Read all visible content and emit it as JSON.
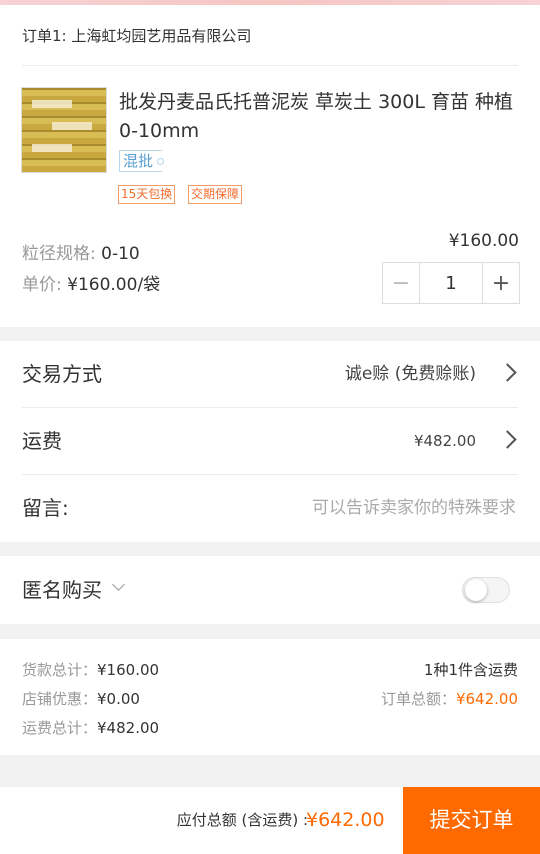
{
  "order": {
    "seller": "订单1: 上海虹均园艺用品有限公司",
    "product_title": "批发丹麦品氏托普泥炭 草炭土 300L 育苗 种植 0-10mm",
    "tag_mixed": "混批",
    "badges": [
      "15天包换",
      "交期保障"
    ],
    "spec_label": "粒径规格:",
    "spec_value": "0-10",
    "unit_price_label": "单价:",
    "unit_price_value": "¥160.00/袋",
    "price": "¥160.00",
    "quantity": "1",
    "minus_symbol": "−",
    "plus_symbol": "+"
  },
  "options": {
    "trade_label": "交易方式",
    "trade_value": "诚e赊 (免费赊账)",
    "shipping_label": "运费",
    "shipping_value": "¥482.00",
    "message_label": "留言:",
    "message_placeholder": "可以告诉卖家你的特殊要求"
  },
  "anonymous": {
    "label": "匿名购买",
    "enabled": false
  },
  "summary": {
    "goods_label": "货款总计：",
    "goods_value": "¥160.00",
    "discount_label": "店铺优惠：",
    "discount_value": "¥0.00",
    "freight_label": "运费总计：",
    "freight_value": "¥482.00",
    "count_text": "1种1件含运费",
    "order_total_label": "订单总额：",
    "order_total_value": "¥642.00"
  },
  "footer": {
    "payable_label": "应付总额 (含运费) :",
    "payable_value": "¥642.00",
    "submit_label": "提交订单"
  },
  "colors": {
    "accent": "#ff6a00",
    "tag_blue": "#5a9fd4",
    "badge_orange": "#f26c2c"
  }
}
